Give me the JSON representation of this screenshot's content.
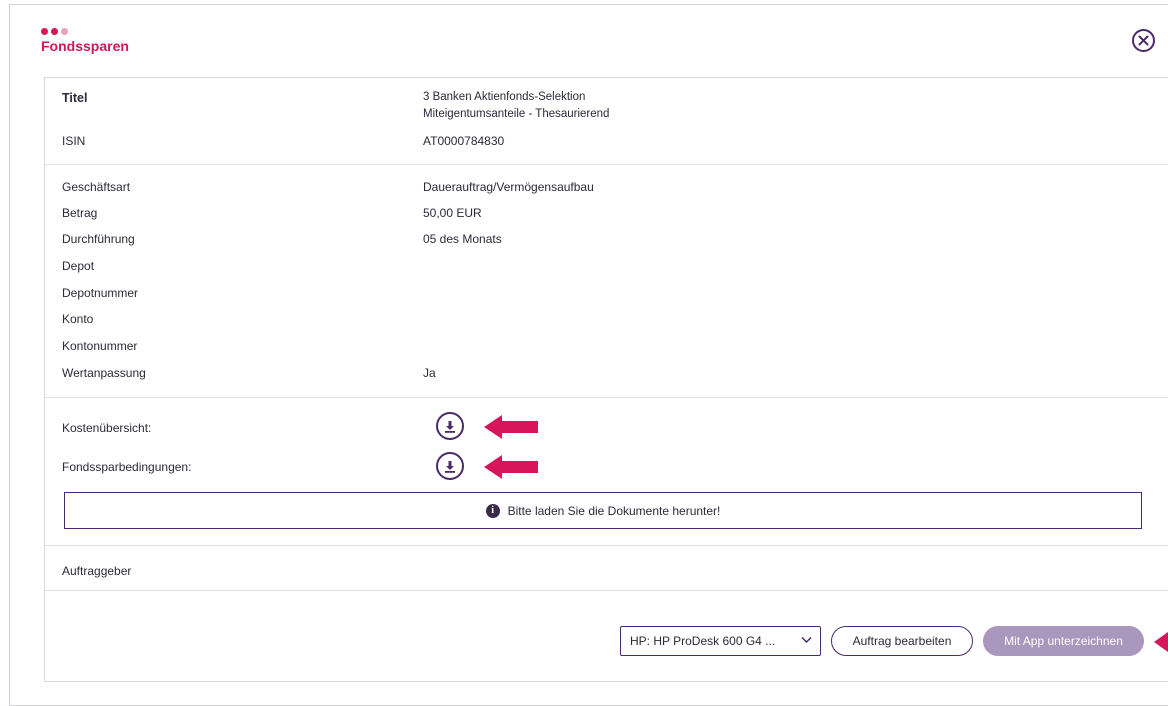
{
  "header": {
    "title": "Fondssparen",
    "dots": [
      "#d6155a",
      "#d6155a",
      "#e8a0bd"
    ]
  },
  "colors": {
    "accent": "#d6155a",
    "brand": "#4b2a6b",
    "button_disabled": "#a997bd"
  },
  "fund": {
    "rows": [
      {
        "label": "Titel",
        "value_line1": "3 Banken Aktienfonds-Selektion",
        "value_line2": "Miteigentumsanteile - Thesaurierend"
      },
      {
        "label": "ISIN",
        "value": "AT0000784830"
      }
    ]
  },
  "details": {
    "rows": [
      {
        "label": "Geschäftsart",
        "value": "Dauerauftrag/Vermögensaufbau"
      },
      {
        "label": "Betrag",
        "value": "50,00 EUR"
      },
      {
        "label": "Durchführung",
        "value": "05 des Monats"
      },
      {
        "label": "Depot",
        "value": ""
      },
      {
        "label": "Depotnummer",
        "value": ""
      },
      {
        "label": "Konto",
        "value": ""
      },
      {
        "label": "Kontonummer",
        "value": ""
      },
      {
        "label": "Wertanpassung",
        "value": "Ja"
      }
    ]
  },
  "documents": {
    "items": [
      {
        "label": "Kostenübersicht:",
        "icon": "download-icon"
      },
      {
        "label": "Fondssparbedingungen:",
        "icon": "download-icon"
      }
    ],
    "info_text": "Bitte laden Sie die Dokumente herunter!"
  },
  "auftraggeber": {
    "label": "Auftraggeber"
  },
  "footer": {
    "device_select": "HP: HP ProDesk 600 G4 ...",
    "edit_button": "Auftrag bearbeiten",
    "sign_button": "Mit App unterzeichnen"
  }
}
